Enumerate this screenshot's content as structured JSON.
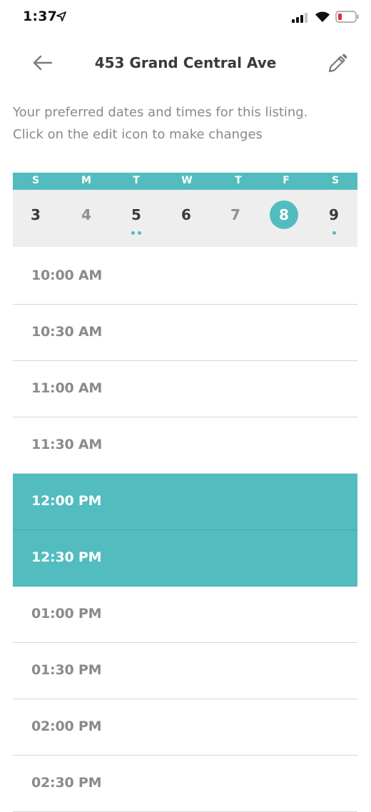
{
  "status_bar": {
    "time": "1:37"
  },
  "header": {
    "title": "453 Grand Central Ave"
  },
  "intro": {
    "line1": "Your preferred dates and times for this listing.",
    "line2": "Click on the edit icon to make changes"
  },
  "calendar": {
    "weekdays": [
      "S",
      "M",
      "T",
      "W",
      "T",
      "F",
      "S"
    ],
    "days": [
      {
        "num": "3",
        "state": "normal",
        "dots": 0
      },
      {
        "num": "4",
        "state": "muted",
        "dots": 0
      },
      {
        "num": "5",
        "state": "normal",
        "dots": 2
      },
      {
        "num": "6",
        "state": "normal",
        "dots": 0
      },
      {
        "num": "7",
        "state": "muted",
        "dots": 0
      },
      {
        "num": "8",
        "state": "selected",
        "dots": 0
      },
      {
        "num": "9",
        "state": "normal",
        "dots": 1
      }
    ]
  },
  "slots": [
    {
      "label": "10:00 AM",
      "selected": false
    },
    {
      "label": "10:30 AM",
      "selected": false
    },
    {
      "label": "11:00 AM",
      "selected": false
    },
    {
      "label": "11:30 AM",
      "selected": false
    },
    {
      "label": "12:00 PM",
      "selected": true
    },
    {
      "label": "12:30 PM",
      "selected": true
    },
    {
      "label": "01:00 PM",
      "selected": false
    },
    {
      "label": "01:30 PM",
      "selected": false
    },
    {
      "label": "02:00 PM",
      "selected": false
    },
    {
      "label": "02:30 PM",
      "selected": false
    }
  ],
  "colors": {
    "accent": "#52bcbf",
    "calendar_bg": "#eeeeee",
    "divider": "#d6d6d6",
    "muted_text": "#8a8a8a",
    "battery_low": "#e0303a"
  },
  "icons": {
    "back": "arrow-left-icon",
    "edit": "pencil-icon",
    "location": "location-arrow-icon",
    "signal": "signal-icon",
    "wifi": "wifi-icon",
    "battery": "battery-icon"
  }
}
